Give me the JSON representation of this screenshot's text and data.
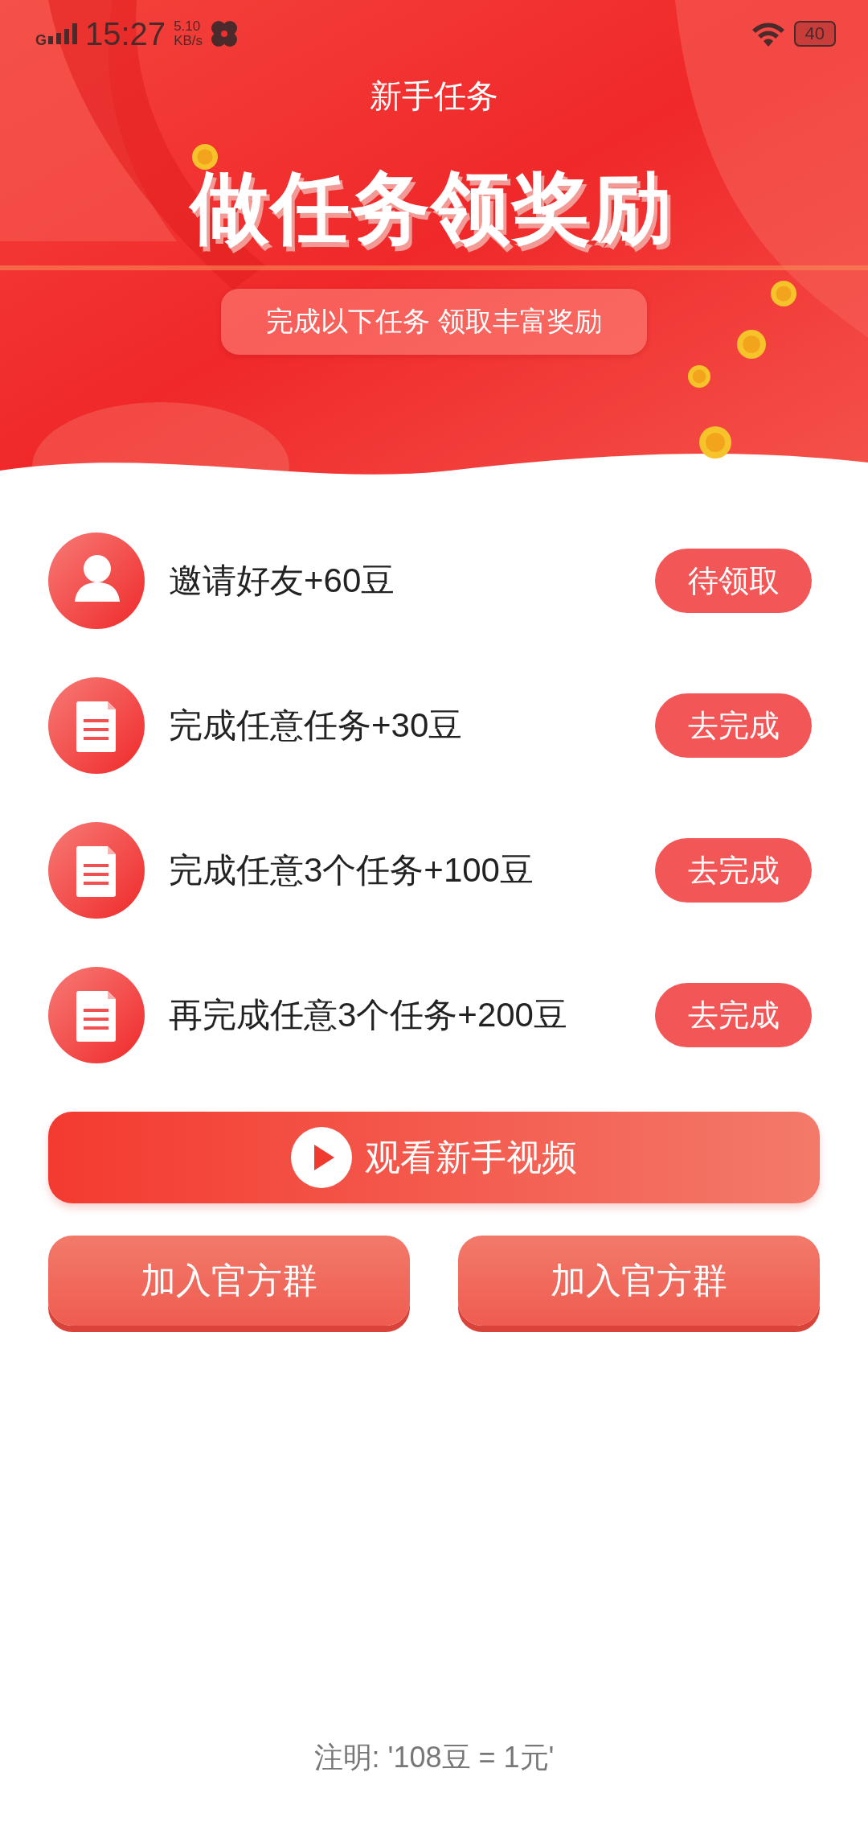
{
  "status_bar": {
    "network": "G",
    "time": "15:27",
    "speed": "5.10",
    "speed_unit": "KB/s",
    "battery": "40"
  },
  "title": "新手任务",
  "banner": {
    "headline": "做任务领奖励",
    "subtitle": "完成以下任务 领取丰富奖励"
  },
  "tasks": [
    {
      "kind": "person",
      "label": "邀请好友+60豆",
      "action": "待领取"
    },
    {
      "kind": "document",
      "label": "完成任意任务+30豆",
      "action": "去完成"
    },
    {
      "kind": "document",
      "label": "完成任意3个任务+100豆",
      "action": "去完成"
    },
    {
      "kind": "document",
      "label": "再完成任意3个任务+200豆",
      "action": "去完成"
    }
  ],
  "video_button": "观看新手视频",
  "group_buttons": [
    "加入官方群",
    "加入官方群"
  ],
  "note": "注明: '108豆 = 1元'"
}
